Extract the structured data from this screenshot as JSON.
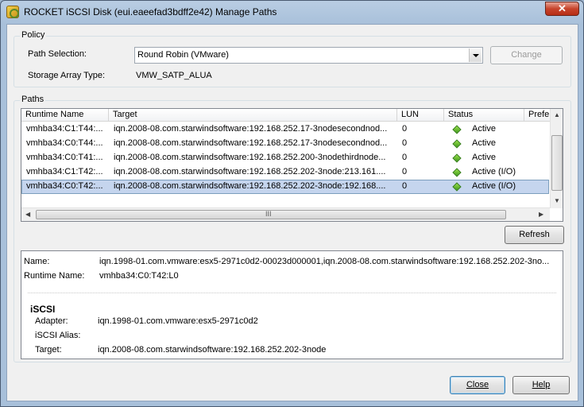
{
  "window": {
    "title": "ROCKET iSCSI Disk (eui.eaeefad3bdff2e42) Manage Paths",
    "close_glyph": "✕"
  },
  "policy": {
    "legend": "Policy",
    "path_selection_label": "Path Selection:",
    "path_selection_value": "Round Robin (VMware)",
    "change_button": "Change",
    "storage_array_type_label": "Storage Array Type:",
    "storage_array_type_value": "VMW_SATP_ALUA"
  },
  "paths": {
    "legend": "Paths",
    "columns": [
      "Runtime Name",
      "Target",
      "LUN",
      "Status",
      "Prefe"
    ],
    "rows": [
      {
        "runtime": "vmhba34:C1:T44:...",
        "target": "iqn.2008-08.com.starwindsoftware:192.168.252.17-3nodesecondnod...",
        "lun": "0",
        "status": "Active"
      },
      {
        "runtime": "vmhba34:C0:T44:...",
        "target": "iqn.2008-08.com.starwindsoftware:192.168.252.17-3nodesecondnod...",
        "lun": "0",
        "status": "Active"
      },
      {
        "runtime": "vmhba34:C0:T41:...",
        "target": "iqn.2008-08.com.starwindsoftware:192.168.252.200-3nodethirdnode...",
        "lun": "0",
        "status": "Active"
      },
      {
        "runtime": "vmhba34:C1:T42:...",
        "target": "iqn.2008-08.com.starwindsoftware:192.168.252.202-3node:213.161....",
        "lun": "0",
        "status": "Active (I/O)"
      },
      {
        "runtime": "vmhba34:C0:T42:...",
        "target": "iqn.2008-08.com.starwindsoftware:192.168.252.202-3node:192.168....",
        "lun": "0",
        "status": "Active (I/O)"
      }
    ],
    "selected_row": 4,
    "status_color": "#4caf1f",
    "hscroll_grip": "III",
    "refresh_button": "Refresh"
  },
  "details": {
    "name_label": "Name:",
    "name_value": "iqn.1998-01.com.vmware:esx5-2971c0d2-00023d000001,iqn.2008-08.com.starwindsoftware:192.168.252.202-3no...",
    "runtime_label": "Runtime Name:",
    "runtime_value": "vmhba34:C0:T42:L0",
    "section_title": "iSCSI",
    "adapter_label": "Adapter:",
    "adapter_value": "iqn.1998-01.com.vmware:esx5-2971c0d2",
    "alias_label": "iSCSI Alias:",
    "alias_value": "",
    "target_label": "Target:",
    "target_value": "iqn.2008-08.com.starwindsoftware:192.168.252.202-3node"
  },
  "footer": {
    "close_button": "Close",
    "help_button": "Help"
  }
}
